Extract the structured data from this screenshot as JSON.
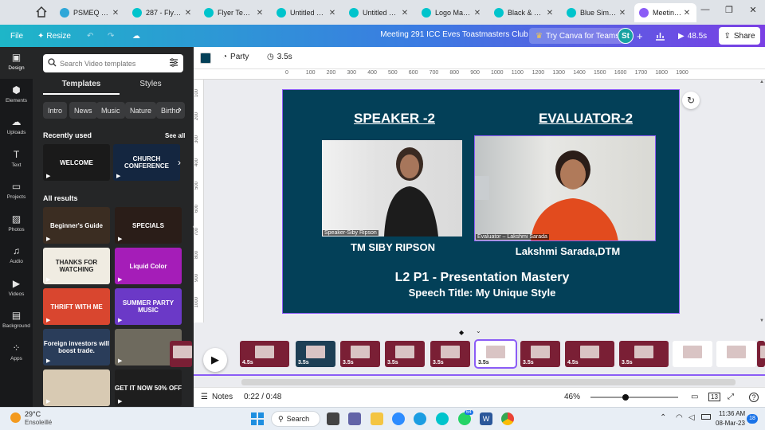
{
  "browser": {
    "tabs": [
      {
        "label": "PSMEQ TMC ...",
        "color": "#2ea7d8"
      },
      {
        "label": "287 - Flyer (A4)",
        "color": "#00c4cc"
      },
      {
        "label": "Flyer Templat...",
        "color": "#00c4cc"
      },
      {
        "label": "Untitled desig...",
        "color": "#00c4cc"
      },
      {
        "label": "Untitled desig...",
        "color": "#00c4cc"
      },
      {
        "label": "Logo Marca P...",
        "color": "#00c4cc"
      },
      {
        "label": "Black & Orang...",
        "color": "#00c4cc"
      },
      {
        "label": "Blue Simple I...",
        "color": "#00c4cc"
      },
      {
        "label": "Meeting 291 I...",
        "color": "#8b5cf6"
      }
    ],
    "new_tab": "+",
    "win_min": "—",
    "win_max": "❐",
    "win_close": "✕"
  },
  "header": {
    "home_icon": "home-icon",
    "file_label": "File",
    "resize_label": "Resize",
    "title": "Meeting 291 ICC Eves Toastmasters Club",
    "try_teams": "Try Canva for Teams",
    "avatar_initials": "St",
    "add": "+",
    "play_duration": "48.5s",
    "share_label": "Share"
  },
  "rail": [
    {
      "label": "Design",
      "icon": "▣"
    },
    {
      "label": "Elements",
      "icon": "⬢"
    },
    {
      "label": "Uploads",
      "icon": "☁"
    },
    {
      "label": "Text",
      "icon": "T"
    },
    {
      "label": "Projects",
      "icon": "▭"
    },
    {
      "label": "Photos",
      "icon": "▨"
    },
    {
      "label": "Audio",
      "icon": "♫"
    },
    {
      "label": "Videos",
      "icon": "▶"
    },
    {
      "label": "Background",
      "icon": "▤"
    },
    {
      "label": "Apps",
      "icon": "⁘"
    }
  ],
  "panel": {
    "search_placeholder": "Search Video templates",
    "tabs": [
      "Templates",
      "Styles"
    ],
    "chips": [
      "Intro",
      "News",
      "Music",
      "Nature",
      "Birthd"
    ],
    "recently_used": "Recently used",
    "see_all": "See all",
    "all_results": "All results",
    "recent_thumbs": [
      {
        "text": "WELCOME",
        "bg": "#1a1a1a"
      },
      {
        "text": "CHURCH CONFERENCE",
        "bg": "#142640"
      }
    ],
    "result_thumbs": [
      {
        "text": "Beginner's Guide",
        "bg": "#3b2d22"
      },
      {
        "text": "SPECIALS",
        "bg": "#2a1d18"
      },
      {
        "text": "THANKS FOR WATCHING",
        "bg": "#f0ece2"
      },
      {
        "text": "Liquid Color",
        "bg": "#a51db8"
      },
      {
        "text": "THRIFT WITH ME",
        "bg": "#d9462f"
      },
      {
        "text": "SUMMER PARTY MUSIC",
        "bg": "#6b39c7"
      },
      {
        "text": "Foreign investors will boost trade.",
        "bg": "#2a3d5a"
      },
      {
        "text": "",
        "bg": "#6e6a5e"
      },
      {
        "text": "",
        "bg": "#d8cab3"
      },
      {
        "text": "GET IT NOW 50% OFF",
        "bg": "#1e1e1e"
      }
    ]
  },
  "toolbar": {
    "color_swatch": "#034058",
    "party_label": "Party",
    "duration_label": "3.5s"
  },
  "ruler": [
    "0",
    "100",
    "200",
    "300",
    "400",
    "500",
    "600",
    "700",
    "800",
    "900",
    "1000",
    "1100",
    "1200",
    "1300",
    "1400",
    "1500",
    "1600",
    "1700",
    "1800",
    "1900"
  ],
  "ruler_left": [
    "100",
    "200",
    "300",
    "400",
    "500",
    "600",
    "700",
    "800",
    "900",
    "1000"
  ],
  "slide": {
    "heading_left": "SPEAKER -2",
    "heading_right": "EVALUATOR-2",
    "video_left_label": "Speaker-Siby Ripson",
    "video_right_label": "Evaluator – Lakshmi Sarada",
    "name_left": "TM SIBY RIPSON",
    "name_right": "Lakshmi Sarada,DTM",
    "line1": "L2 P1 - Presentation Mastery",
    "line2": "Speech Title:  My Unique Style"
  },
  "timeline": {
    "clips": [
      {
        "dur": ""
      },
      {
        "dur": "4.5s"
      },
      {
        "dur": "3.5s"
      },
      {
        "dur": "3.5s"
      },
      {
        "dur": "3.5s"
      },
      {
        "dur": "3.5s"
      },
      {
        "dur": "3.5s"
      },
      {
        "dur": "3.5s"
      },
      {
        "dur": "4.5s"
      },
      {
        "dur": "3.5s"
      },
      {
        "dur": "3.5s"
      },
      {
        "dur": "3.5s"
      },
      {
        "dur": ""
      }
    ]
  },
  "footer": {
    "notes_label": "Notes",
    "time": "0:22 / 0:48",
    "zoom": "46%",
    "page_count": "13",
    "help": "?"
  },
  "taskbar": {
    "temp": "29°C",
    "weather": "Ensoleillé",
    "search_label": "Search",
    "whatsapp_badge": "64",
    "time": "11:36 AM",
    "date": "08-Mar-23",
    "notif_count": "18"
  }
}
